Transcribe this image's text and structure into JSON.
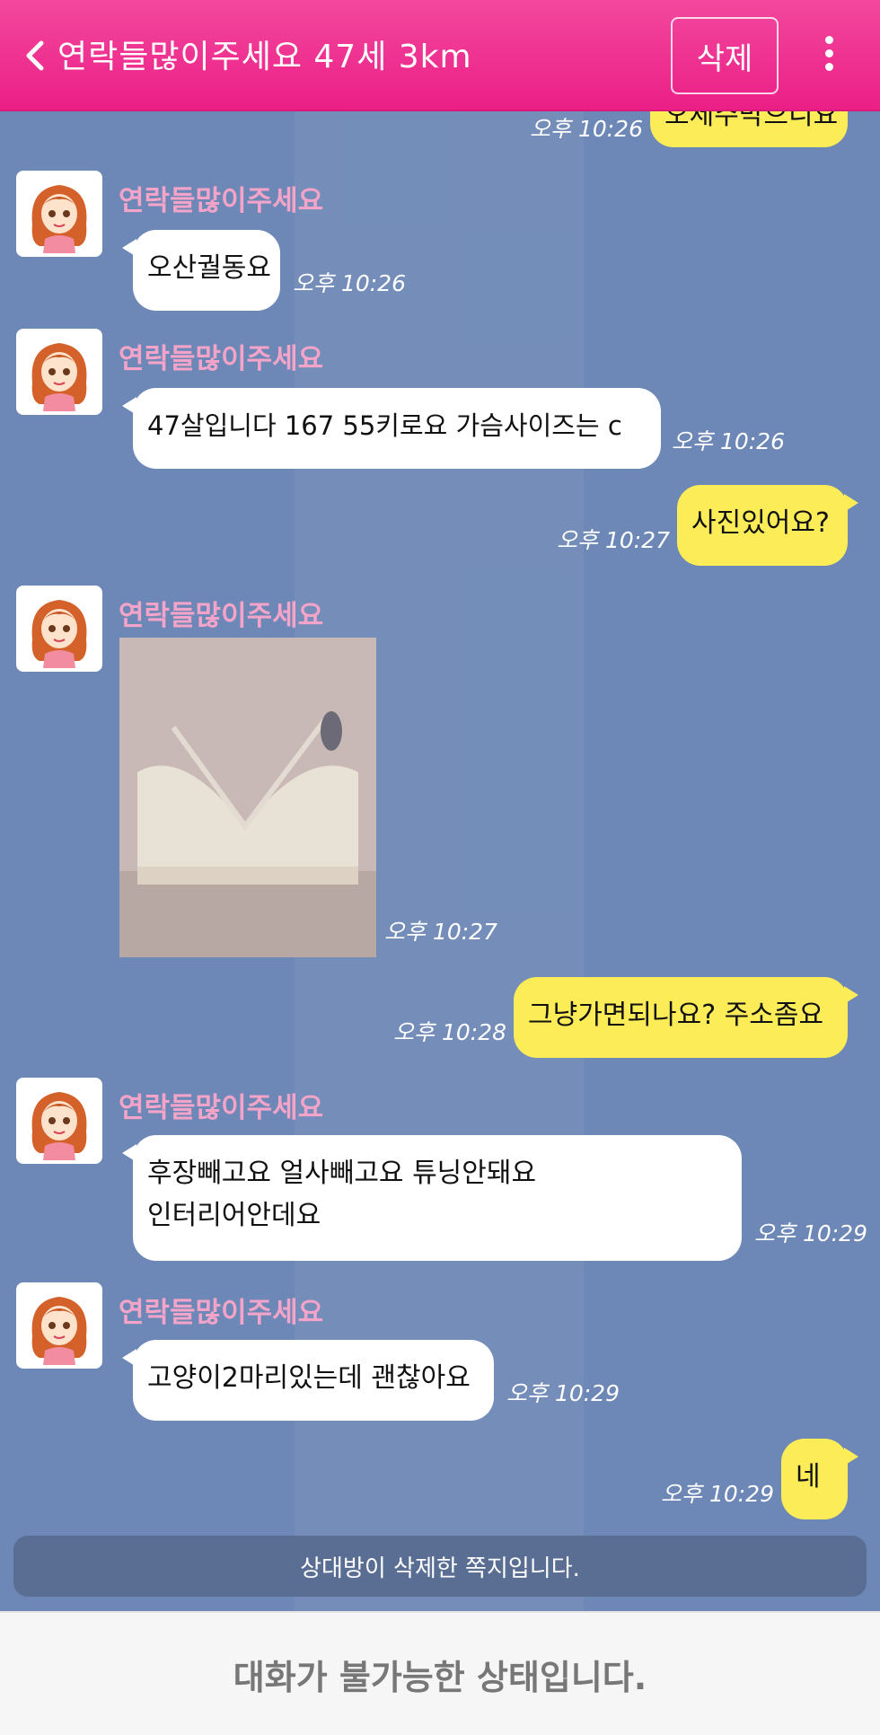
{
  "header": {
    "title": "연락들많이주세요 47세 3km",
    "delete_label": "삭제"
  },
  "messages": {
    "top_partial": {
      "time": "오후 10:26",
      "text": "오세주막으니요"
    },
    "m1": {
      "name": "연락들많이주세요",
      "text": "오산궐동요",
      "time": "오후 10:26"
    },
    "m2": {
      "name": "연락들많이주세요",
      "text": "47살입니다 167 55키로요 가슴사이즈는 c",
      "time": "오후 10:26"
    },
    "m3": {
      "text": "사진있어요?",
      "time": "오후 10:27"
    },
    "m4": {
      "name": "연락들많이주세요",
      "time": "오후 10:27"
    },
    "m5": {
      "text": "그냥가면되나요? 주소좀요",
      "time": "오후 10:28"
    },
    "m6": {
      "name": "연락들많이주세요",
      "line1": "후장빼고요 얼사빼고요 튜닝안돼요",
      "line2": "인터리어안데요",
      "time": "오후 10:29"
    },
    "m7": {
      "name": "연락들많이주세요",
      "text": "고양이2마리있는데 괜찮아요",
      "time": "오후 10:29"
    },
    "m8": {
      "text": "네",
      "time": "오후 10:29"
    }
  },
  "notice": "상대방이 삭제한 쪽지입니다.",
  "footer": "대화가 불가능한 상태입니다.",
  "colors": {
    "header": "#ec1f87",
    "background": "#6d88b6",
    "out_bubble": "#fbec58",
    "name": "#f3a4c8"
  }
}
